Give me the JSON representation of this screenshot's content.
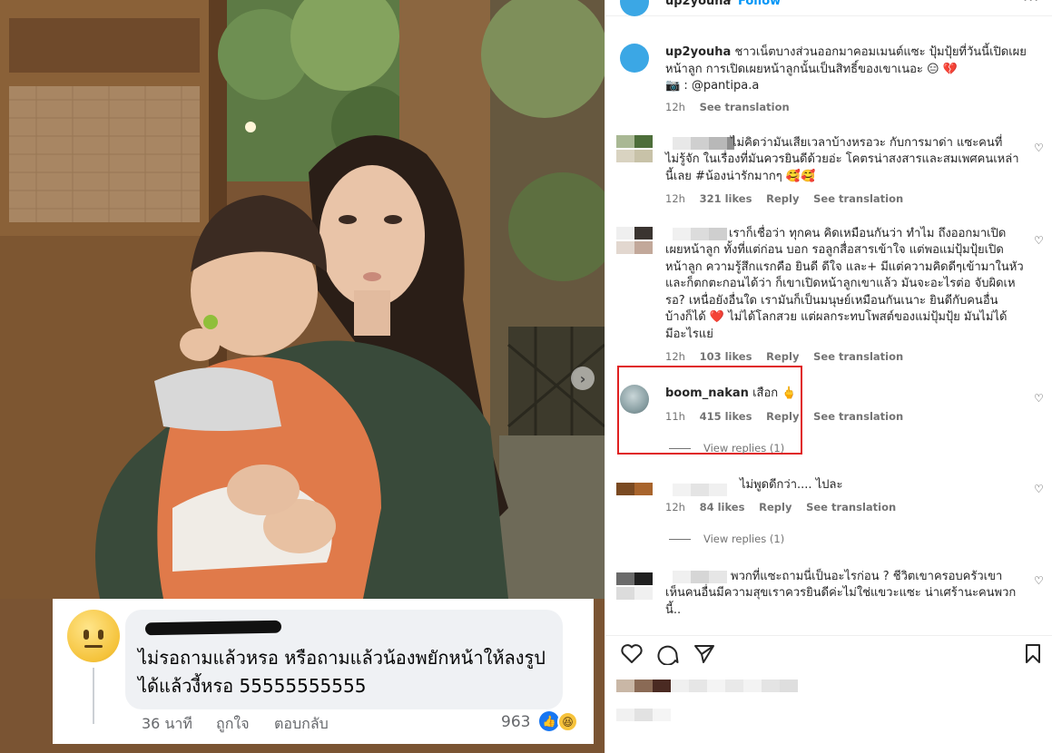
{
  "header": {
    "username": "up2youha",
    "separator": "•",
    "follow_label": "Follow",
    "more_label": "···"
  },
  "caption": {
    "username": "up2youha",
    "line1": "ชาวเน็ตบางส่วนออกมาคอมเมนต์แซะ ปุ้มปุ้ยที่วันนี้เปิดเผย",
    "line2": "หน้าลูก การเปิดเผยหน้าลูกนั้นเป็นสิทธิ์ของเขาเนอะ 😑 💔",
    "line3": "📷 : @pantipa.a",
    "time": "12h",
    "see_translation": "See translation"
  },
  "comments": [
    {
      "lines": [
        "ไม่คิดว่ามันเสียเวลาบ้างหรอวะ กับการมาด่า แซะคนที่",
        "ไม่รู้จัก ในเรื่องที่มันควรยินดีด้วยอ่ะ โคตรน่าสงสารและสมเพศคนเหล่า",
        "นี้เลย #น้องน่ารักมากๆ 🥰🥰"
      ],
      "time": "12h",
      "likes": "321 likes",
      "reply": "Reply",
      "see_translation": "See translation"
    },
    {
      "lines": [
        "เราก็เชื่อว่า ทุกคน คิดเหมือนกันว่า ทำไม ถึงออกมาเปิด",
        "เผยหน้าลูก ทั้งที่แต่ก่อน บอก รอลูกสื่อสารเข้าใจ แต่พอแม่ปุ้มปุ้ยเปิด",
        "หน้าลูก ความรู้สึกแรกคือ ยินดี ดีใจ และ+ มีแต่ความคิดดีๆเข้ามาในหัว",
        "และก็ตกตะกอนได้ว่า ก็เขาเปิดหน้าลูกเขาแล้ว มันจะอะไรต่อ จับผิดเห",
        "รอ? เหนื่อยังอื่นใด เรามันก็เป็นมนุษย์เหมือนกันเนาะ ยินดีกับคนอื่น",
        "บ้างก็ได้ ❤️ ไม่ได้โลกสวย แต่ผลกระทบโพสต์ของแม่ปุ้มปุ้ย มันไม่ได้",
        "มีอะไรแย่"
      ],
      "time": "12h",
      "likes": "103 likes",
      "reply": "Reply",
      "see_translation": "See translation"
    },
    {
      "username": "boom_nakan",
      "text": "เสือก 🖕",
      "time": "11h",
      "likes": "415 likes",
      "reply": "Reply",
      "see_translation": "See translation",
      "view_replies": "View replies (1)"
    },
    {
      "lines": [
        "ไม่พูดดีกว่า.... ไปละ"
      ],
      "time": "12h",
      "likes": "84 likes",
      "reply": "Reply",
      "see_translation": "See translation",
      "view_replies": "View replies (1)"
    },
    {
      "lines": [
        "พวกที่แซะถามนี่เป็นอะไรก่อน ? ชีวิตเขาครอบครัวเขา",
        "เห็นคนอื่นมีความสุขเราควรยินดีค่ะไม่ใช่แขวะแซะ น่าเศร้านะคนพวก",
        "นี้.."
      ]
    }
  ],
  "overlay_comment": {
    "text_line1": "ไม่รอถามแล้วหรอ หรือถามแล้วน้องพยักหน้าให้ลงรูป",
    "text_line2": "ได้แล้วงี้หรอ 55555555555",
    "time": "36 นาที",
    "like_label": "ถูกใจ",
    "reply_label": "ตอบกลับ",
    "reaction_count": "963"
  },
  "icons": {
    "heart": "heart-icon",
    "comment": "comment-icon",
    "share": "share-icon",
    "save": "bookmark-icon",
    "next": "chevron-right-icon"
  },
  "colors": {
    "link": "#0095f6",
    "highlight_border": "#e02020",
    "muted_text": "#737373"
  }
}
